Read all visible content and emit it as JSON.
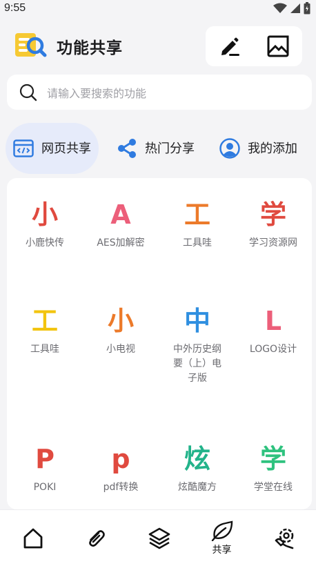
{
  "status_bar": {
    "time": "9:55",
    "icons": [
      "wifi-icon",
      "signal-icon",
      "battery-icon"
    ]
  },
  "header": {
    "title": "功能共享",
    "actions": [
      "edit-icon",
      "image-icon"
    ]
  },
  "search": {
    "placeholder": "请输入要搜索的功能"
  },
  "tabs": [
    {
      "label": "网页共享",
      "icon": "code-window-icon",
      "active": true
    },
    {
      "label": "热门分享",
      "icon": "share-icon",
      "active": false
    },
    {
      "label": "我的添加",
      "icon": "user-icon",
      "active": false
    }
  ],
  "items": [
    {
      "glyph": "小",
      "label": "小鹿快传",
      "color": "#e04a3f"
    },
    {
      "glyph": "A",
      "label": "AES加解密",
      "color": "#ec5f7a"
    },
    {
      "glyph": "工",
      "label": "工具哇",
      "color": "#ec7a2a"
    },
    {
      "glyph": "学",
      "label": "学习资源网",
      "color": "#e04a3f"
    },
    {
      "glyph": "工",
      "label": "工具哇",
      "color": "#f2c40f"
    },
    {
      "glyph": "小",
      "label": "小电视",
      "color": "#ec7a2a"
    },
    {
      "glyph": "中",
      "label": "中外历史纲要（上）电子版",
      "color": "#2f8fe0"
    },
    {
      "glyph": "L",
      "label": "LOGO设计",
      "color": "#ec5f7a"
    },
    {
      "glyph": "P",
      "label": "POKI",
      "color": "#e04a3f"
    },
    {
      "glyph": "p",
      "label": "pdf转换",
      "color": "#e04a3f"
    },
    {
      "glyph": "炫",
      "label": "炫酷魔方",
      "color": "#22b38a"
    },
    {
      "glyph": "学",
      "label": "学堂在线",
      "color": "#2ec27e"
    }
  ],
  "bottom_nav": [
    {
      "icon": "home-icon",
      "label": ""
    },
    {
      "icon": "paperclip-icon",
      "label": ""
    },
    {
      "icon": "layers-icon",
      "label": ""
    },
    {
      "icon": "leaf-icon",
      "label": "共享",
      "active": true
    },
    {
      "icon": "settings-hand-icon",
      "label": ""
    }
  ],
  "colors": {
    "accent": "#2f7be0",
    "active_tab_bg": "#e6ebfa",
    "background": "#f4f4f6"
  }
}
